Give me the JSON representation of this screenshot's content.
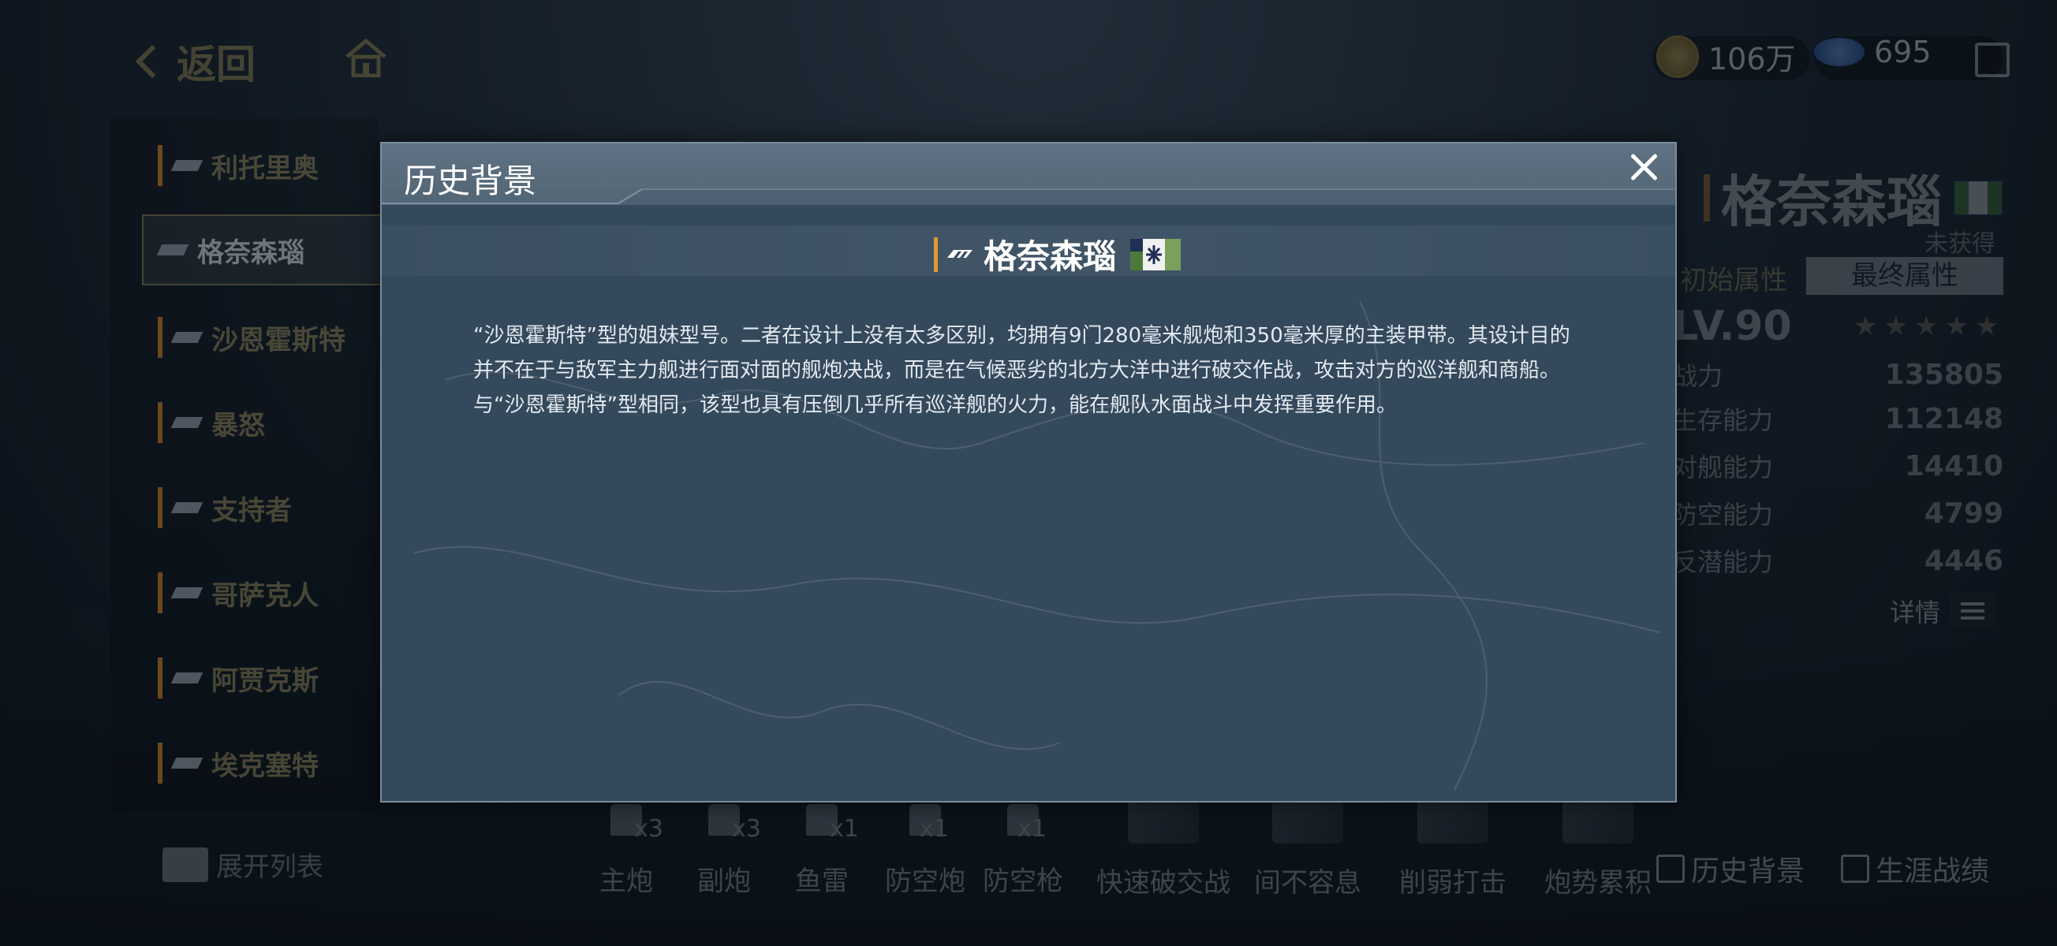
{
  "top_bar": {
    "back_label": "返回",
    "gold_amount": "106万",
    "gem_amount": "695"
  },
  "ship_list": {
    "items": [
      {
        "name": "利托里奥"
      },
      {
        "name": "格奈森瑙"
      },
      {
        "name": "沙恩霍斯特"
      },
      {
        "name": "暴怒"
      },
      {
        "name": "支持者"
      },
      {
        "name": "哥萨克人"
      },
      {
        "name": "阿贾克斯"
      },
      {
        "name": "埃克塞特"
      }
    ],
    "expand_label": "展开列表"
  },
  "right_panel": {
    "ship_name": "格奈森瑙",
    "status": "未获得",
    "tab_initial": "初始属性",
    "tab_final": "最终属性",
    "level": "LV.90",
    "stars": "★★★★★",
    "power_label": "战力",
    "power_value": "135805",
    "stats": [
      {
        "label": "生存能力",
        "value": "112148"
      },
      {
        "label": "对舰能力",
        "value": "14410"
      },
      {
        "label": "防空能力",
        "value": "4799"
      },
      {
        "label": "反潜能力",
        "value": "4446"
      }
    ],
    "details_label": "详情"
  },
  "bottom_bar": {
    "equipment": [
      {
        "label": "主炮",
        "count": "x3"
      },
      {
        "label": "副炮",
        "count": "x3"
      },
      {
        "label": "鱼雷",
        "count": "x1"
      },
      {
        "label": "防空炮",
        "count": "x1"
      },
      {
        "label": "防空枪",
        "count": "x1"
      }
    ],
    "skills": [
      {
        "label": "快速破交战"
      },
      {
        "label": "间不容息"
      },
      {
        "label": "削弱打击"
      },
      {
        "label": "炮势累积"
      }
    ],
    "history_link": "历史背景",
    "career_link": "生涯战绩"
  },
  "modal": {
    "title": "历史背景",
    "ship_name": "格奈森瑙",
    "description": "“沙恩霍斯特”型的姐妹型号。二者在设计上没有太多区别，均拥有9门280毫米舰炮和350毫米厚的主装甲带。其设计目的并不在于与敌军主力舰进行面对面的舰炮决战，而是在气候恶劣的北方大洋中进行破交作战，攻击对方的巡洋舰和商船。与“沙恩霍斯特”型相同，该型也具有压倒几乎所有巡洋舰的火力，能在舰队水面战斗中发挥重要作用。"
  },
  "colors": {
    "accent_gold": "#c9b779",
    "class_bar_orange": "#e09a38",
    "modal_bg": "#34495b",
    "modal_header": "#52667a"
  }
}
